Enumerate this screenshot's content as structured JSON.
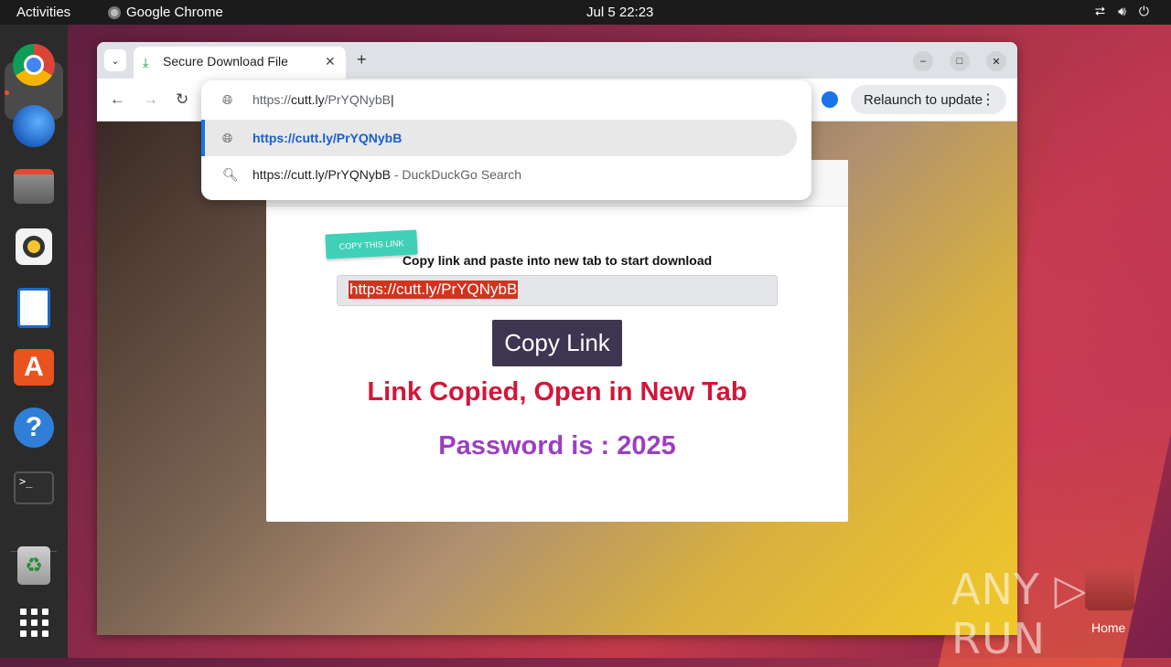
{
  "topbar": {
    "activities": "Activities",
    "app_name": "Google Chrome",
    "clock": "Jul 5  22:23",
    "tray_icons": [
      "network-icon",
      "volume-icon",
      "power-icon"
    ]
  },
  "dock": {
    "items": [
      "chrome-icon",
      "thunderbird-icon",
      "files-icon",
      "rhythmbox-icon",
      "libreoffice-writer-icon",
      "app-center-icon",
      "help-icon",
      "terminal-icon",
      "trash-icon",
      "show-apps-icon"
    ],
    "terminal_prompt": ">_"
  },
  "browser": {
    "tab_title": "Secure Download File",
    "new_tab": "+",
    "relaunch_label": "Relaunch to update",
    "omnibox": {
      "typed_prefix": "https://",
      "typed_host": "cutt.ly",
      "typed_path": "/PrYQNybB",
      "suggestions": [
        {
          "text": "https://cutt.ly/PrYQNybB",
          "suffix": "",
          "icon": "globe-icon"
        },
        {
          "text": "https://cutt.ly/PrYQNybB",
          "suffix": " - DuckDuckGo Search",
          "icon": "search-icon"
        }
      ]
    }
  },
  "page": {
    "sticker": "COPY THIS LINK",
    "instruction": "Copy link and paste into new tab to start download",
    "link_value": "https://cutt.ly/PrYQNybB",
    "copy_button": "Copy Link",
    "copied_message": "Link Copied, Open in New Tab",
    "password_message": "Password is : 2025"
  },
  "desktop": {
    "watermark": "ANY ▷ RUN",
    "home_label": "Home"
  },
  "colors": {
    "copied": "#d2163a",
    "password": "#9b3fc0",
    "copy_button_bg": "#3e3650",
    "link_highlight": "#d2331f",
    "sticker": "#40d0b8"
  }
}
